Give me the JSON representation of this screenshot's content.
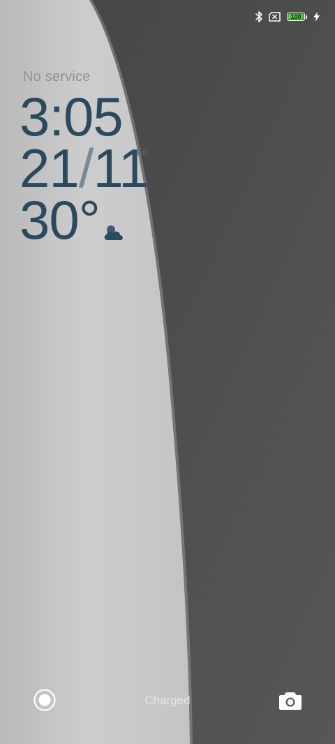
{
  "status_bar": {
    "icons": [
      "bluetooth-icon",
      "no-sim-icon",
      "battery-icon",
      "charging-bolt-icon"
    ],
    "battery_level": "100",
    "battery_color": "#4cd137"
  },
  "lock_screen": {
    "carrier": "No service",
    "time": "3:05",
    "date_day": "21",
    "date_sep": "/",
    "date_month": "11",
    "weekday": "Fri",
    "temperature": "30°",
    "weather_icon": "partly-cloudy-icon",
    "text_color": "#2a4a5e"
  },
  "bottom_bar": {
    "left_shortcut_icon": "record-icon",
    "charge_status": "Charged",
    "right_shortcut_icon": "camera-icon"
  }
}
